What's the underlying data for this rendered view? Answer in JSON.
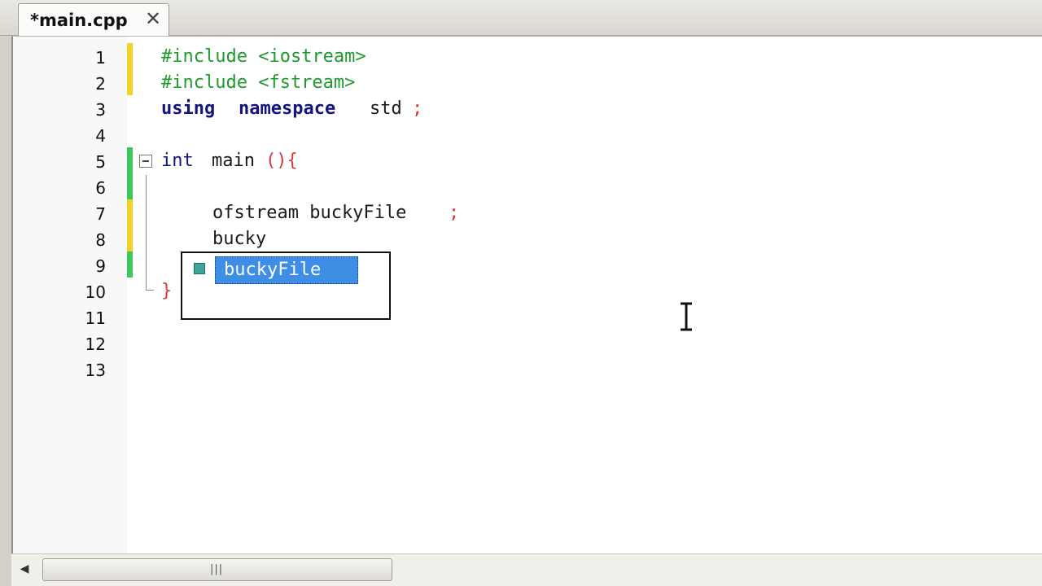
{
  "tab": {
    "label": "*main.cpp",
    "close_glyph": "✕"
  },
  "lines": [
    {
      "n": "1",
      "pre": "#include <iostream>"
    },
    {
      "n": "2",
      "pre": "#include <fstream>"
    },
    {
      "n": "3",
      "kw1": "using",
      "kw2": "namespace",
      "id": "std",
      "punc": ";"
    },
    {
      "n": "4"
    },
    {
      "n": "5",
      "kw": "int",
      "id": "main",
      "punc": "(){"
    },
    {
      "n": "6"
    },
    {
      "n": "7",
      "id": "ofstream buckyFile",
      "punc": ";"
    },
    {
      "n": "8",
      "id": "bucky"
    },
    {
      "n": "9"
    },
    {
      "n": "10",
      "punc": "}"
    },
    {
      "n": "11"
    },
    {
      "n": "12"
    },
    {
      "n": "13"
    }
  ],
  "autocomplete": {
    "item": "buckyFile",
    "icon": "member-variable-icon"
  },
  "scrollbar": {
    "left_arrow": "◀",
    "grip": "|||"
  },
  "colors": {
    "modified_line": "#f2d226",
    "saved_line": "#3cc85a",
    "selection": "#3e8ee6"
  }
}
